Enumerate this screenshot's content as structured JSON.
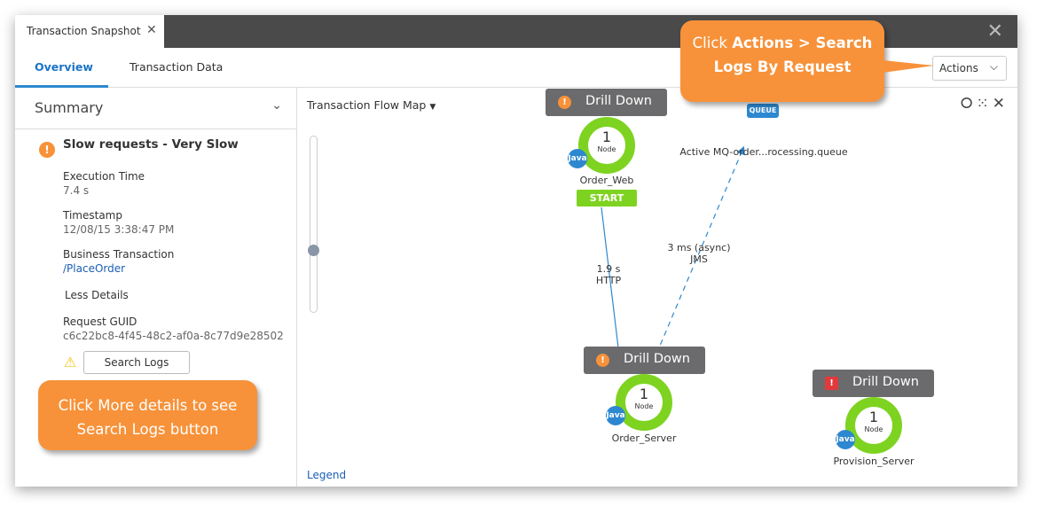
{
  "window": {
    "tab_title": "Transaction Snapshot",
    "tab_close": "✕",
    "close": "✕"
  },
  "subtabs": [
    {
      "label": "Overview",
      "active": true
    },
    {
      "label": "Transaction Data",
      "active": false
    }
  ],
  "actions": {
    "label": "Actions",
    "chevron": "⌵"
  },
  "summary": {
    "title": "Summary",
    "chevron": "⌄",
    "alert": "Slow requests - Very Slow",
    "fields": [
      {
        "label": "Execution Time",
        "value": "7.4 s"
      },
      {
        "label": "Timestamp",
        "value": "12/08/15 3:38:47 PM"
      },
      {
        "label": "Business Transaction",
        "value": "/PlaceOrder"
      }
    ],
    "less_details": "Less Details",
    "guid_label": "Request GUID",
    "guid": "c6c22bc8-4f45-48c2-af0a-8c77d9e28502",
    "search_logs": "Search Logs"
  },
  "callouts": {
    "actions_pre": "Click ",
    "actions_bold1": "Actions > Search",
    "actions_bold2": "Logs By Request",
    "details": "Click More details to see Search Logs button"
  },
  "map": {
    "title": "Transaction Flow Map",
    "legend": "Legend",
    "nodes": [
      {
        "name": "Order_Web",
        "count": "1",
        "unit": "Node",
        "badge": "Java",
        "drill": "Drill Down",
        "status": "warning",
        "start": "START"
      },
      {
        "name": "Order_Server",
        "count": "1",
        "unit": "Node",
        "badge": "Java",
        "drill": "Drill Down",
        "status": "warning"
      },
      {
        "name": "Provision_Server",
        "count": "1",
        "unit": "Node",
        "badge": "Java",
        "drill": "Drill Down",
        "status": "error"
      }
    ],
    "queue": {
      "badge": "QUEUE",
      "name": "Active MQ-order...rocessing.queue"
    },
    "edges": [
      {
        "time": "1.9 s",
        "type": "HTTP"
      },
      {
        "time": "3 ms (async)",
        "type": "JMS"
      }
    ]
  },
  "colors": {
    "accent": "#2d88d0",
    "callout": "#f7923a",
    "ring": "#7ed321",
    "warning": "#f7923a",
    "error": "#e2393d"
  }
}
